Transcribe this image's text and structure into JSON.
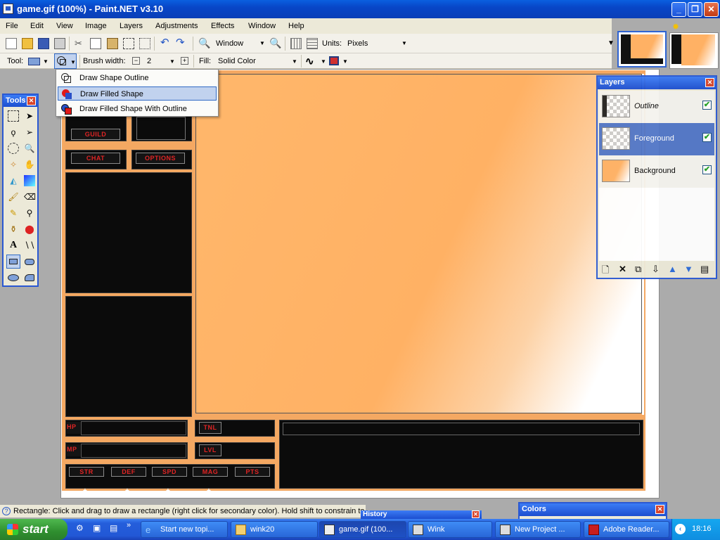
{
  "window": {
    "title": "game.gif (100%) - Paint.NET v3.10",
    "controls": [
      "minimize",
      "restore",
      "close"
    ]
  },
  "menu": [
    "File",
    "Edit",
    "View",
    "Image",
    "Layers",
    "Adjustments",
    "Effects",
    "Window",
    "Help"
  ],
  "toolbar": {
    "zoom_label": "Window",
    "units_label": "Units:",
    "units_value": "Pixels"
  },
  "options_bar": {
    "tool_label": "Tool:",
    "brush_width_label": "Brush width:",
    "brush_width_value": "2",
    "fill_label": "Fill:",
    "fill_value": "Solid Color"
  },
  "shape_menu": {
    "items": [
      "Draw Shape Outline",
      "Draw Filled Shape",
      "Draw Filled Shape With Outline"
    ],
    "selected": "Draw Filled Shape"
  },
  "tools_window": {
    "title": "Tools"
  },
  "layers_window": {
    "title": "Layers",
    "layers": [
      {
        "name": "Outline",
        "visible": true
      },
      {
        "name": "Foreground",
        "visible": true,
        "selected": true
      },
      {
        "name": "Background",
        "visible": true
      }
    ]
  },
  "game_ui": {
    "top_buttons": [
      "GUILD",
      "CHAT",
      "OPTIONS"
    ],
    "stat_labels": [
      "HP",
      "TNL",
      "MP",
      "LVL"
    ],
    "attr_labels": [
      "STR",
      "DEF",
      "SPD",
      "MAG",
      "PTS"
    ],
    "plus": "+"
  },
  "status_bar": "Rectangle: Click and drag to draw a rectangle (right click for secondary color). Hold shift to constrain to",
  "history_window": {
    "title": "History"
  },
  "colors_window": {
    "title": "Colors"
  },
  "taskbar": {
    "start": "start",
    "tasks": [
      "Start new topi...",
      "wink20",
      "game.gif (100...",
      "Wink",
      "New Project ...",
      "Adobe Reader..."
    ],
    "time": "18:16"
  },
  "colors": {
    "titlebar": "#0a4fd8",
    "canvas_orange": "#f4a862",
    "selection": "#5176c7"
  }
}
